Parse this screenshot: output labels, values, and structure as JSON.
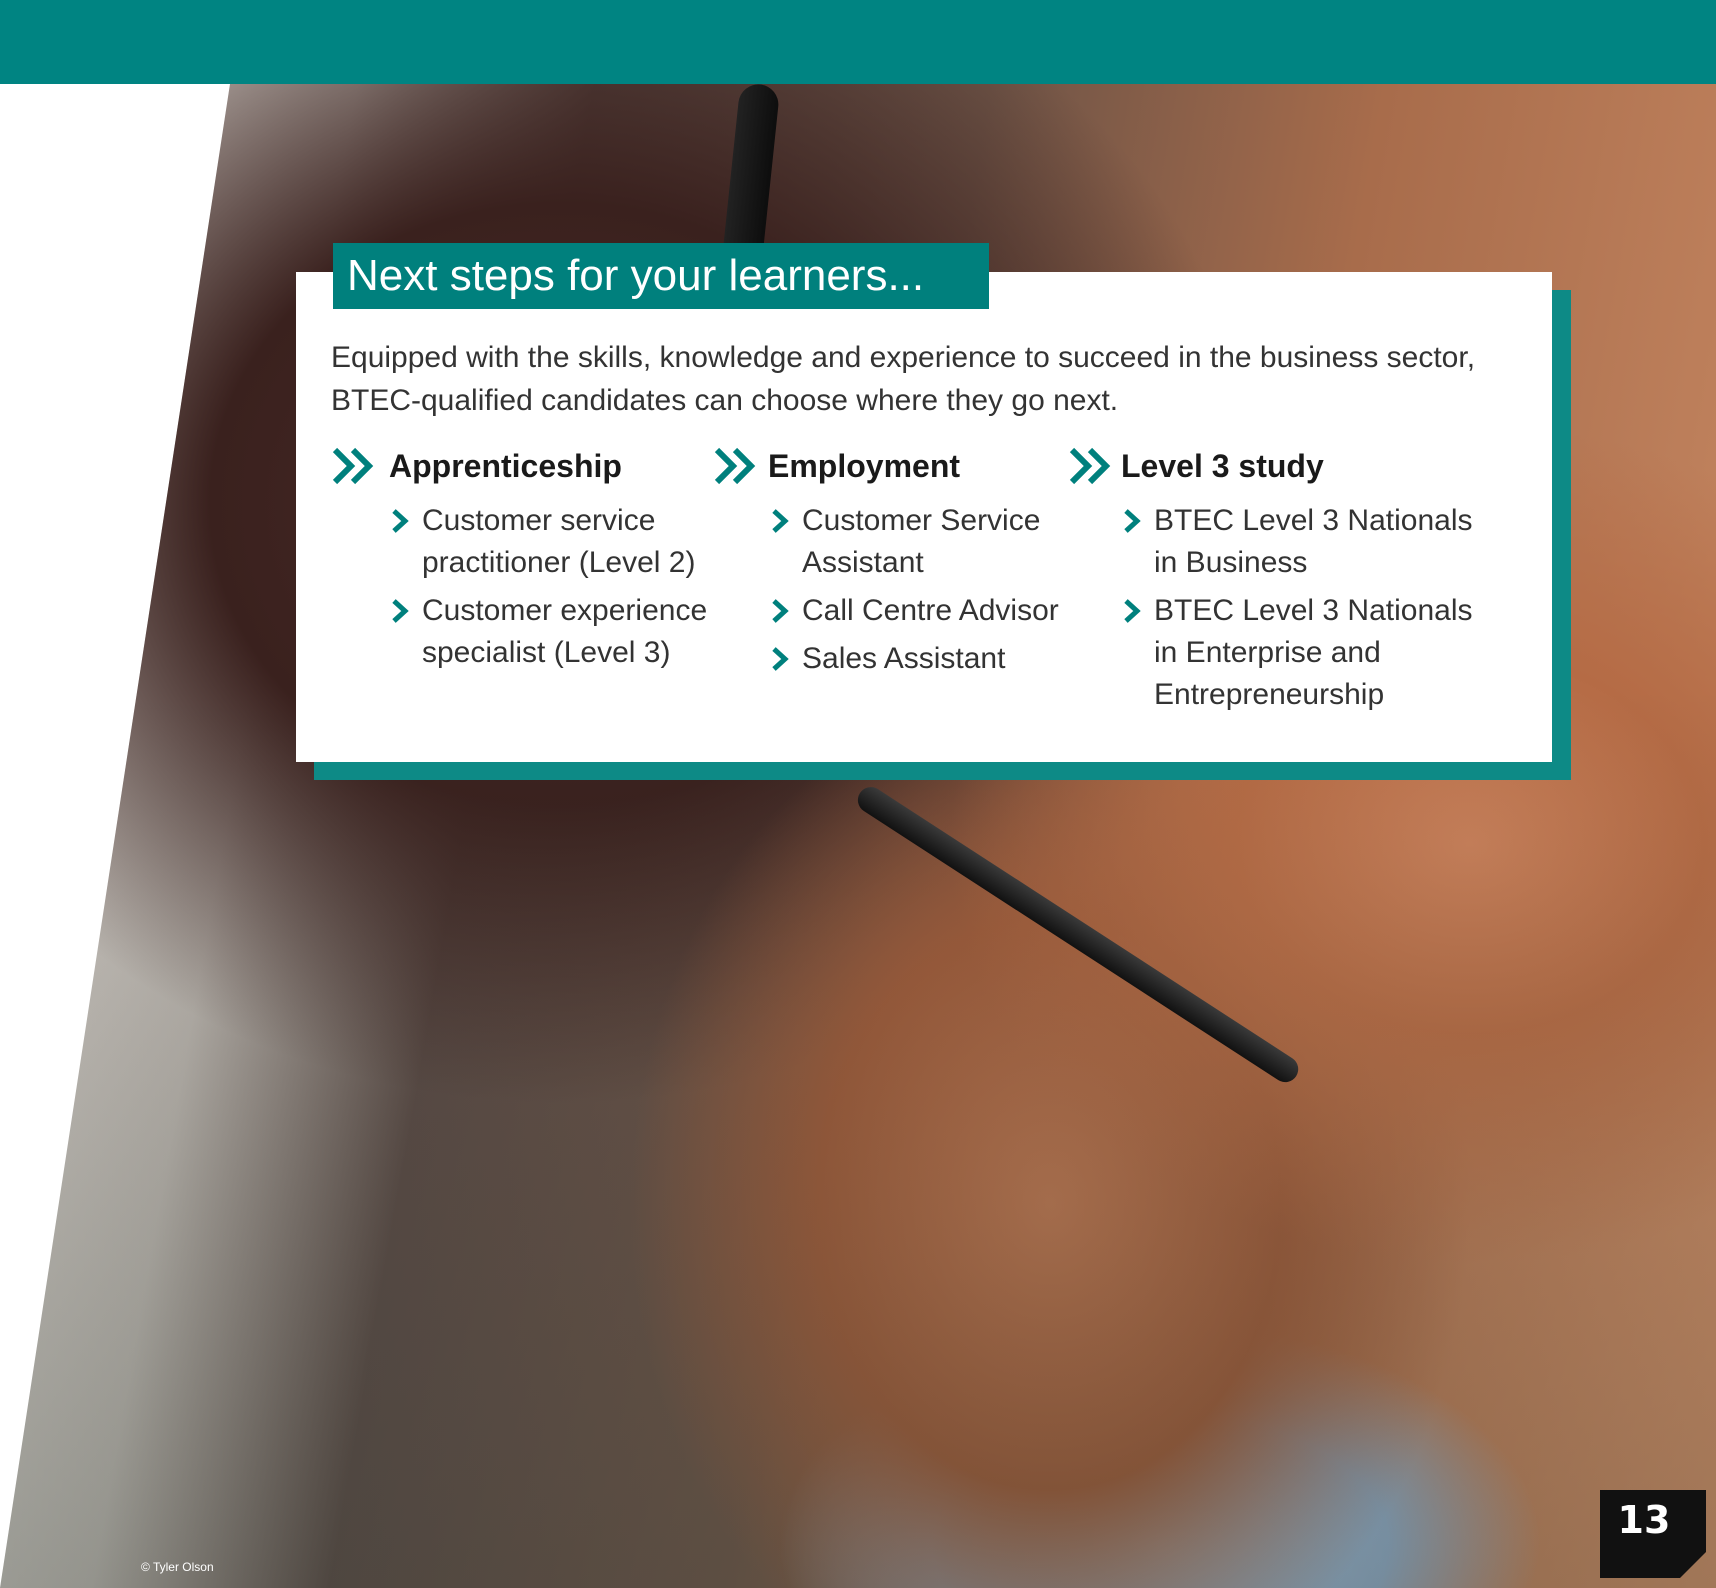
{
  "header": {
    "title": "Next steps for your learners..."
  },
  "intro": "Equipped with the skills, knowledge and experience to succeed in the business sector, BTEC-qualified candidates can choose where they go next.",
  "columns": [
    {
      "heading": "Apprenticeship",
      "items": [
        "Customer service practitioner (Level 2)",
        "Customer experience specialist (Level 3)"
      ]
    },
    {
      "heading": "Employment",
      "items": [
        "Customer Service Assistant",
        "Call Centre Advisor",
        "Sales Assistant"
      ]
    },
    {
      "heading": "Level 3 study",
      "items": [
        "BTEC Level 3 Nationals in Business",
        "BTEC Level 3 Nationals in Enterprise and Entrepreneurship"
      ]
    }
  ],
  "photo_credit": "© Tyler Olson",
  "page_number": "13",
  "colors": {
    "teal": "#00807d",
    "teal_shadow": "#0d8a86",
    "text": "#333333"
  },
  "icons": {
    "section": "double-chevron-icon",
    "bullet": "chevron-right-icon"
  }
}
